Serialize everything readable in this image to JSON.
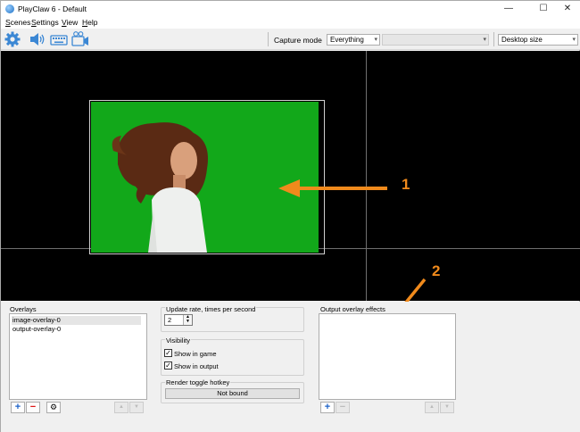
{
  "window": {
    "title": "PlayClaw 6 - Default",
    "minimize": "—",
    "maximize": "☐",
    "close": "✕"
  },
  "menu": [
    {
      "label": "Scenes"
    },
    {
      "label": "Settings"
    },
    {
      "label": "View"
    },
    {
      "label": "Help"
    }
  ],
  "toolbar": {
    "icons": [
      "settings-gear-icon",
      "audio-speaker-icon",
      "keyboard-icon",
      "camera-icon"
    ],
    "capture_mode_label": "Capture mode",
    "capture_mode_value": "Everything",
    "target_value": "",
    "size_value": "Desktop size"
  },
  "preview": {
    "callout_1": "1",
    "callout_2": "2",
    "arrow_color": "#f08a1c",
    "background_color": "#12a81a"
  },
  "overlays": {
    "label": "Overlays",
    "items": [
      "image-overlay-0",
      "output-overlay-0"
    ],
    "selected_index": 0
  },
  "update_rate": {
    "label": "Update rate, times per second",
    "value": "2"
  },
  "visibility": {
    "label": "Visibility",
    "show_in_game": {
      "label": "Show in game",
      "checked": true
    },
    "show_in_output": {
      "label": "Show in output",
      "checked": true
    }
  },
  "hotkey": {
    "label": "Render toggle hotkey",
    "value": "Not bound"
  },
  "effects": {
    "label": "Output overlay effects",
    "items": []
  },
  "glyphs": {
    "plus": "+",
    "minus": "−",
    "gear": "⚙",
    "up": "▲",
    "down": "▼",
    "check": "✓",
    "dropdown": "▾"
  }
}
